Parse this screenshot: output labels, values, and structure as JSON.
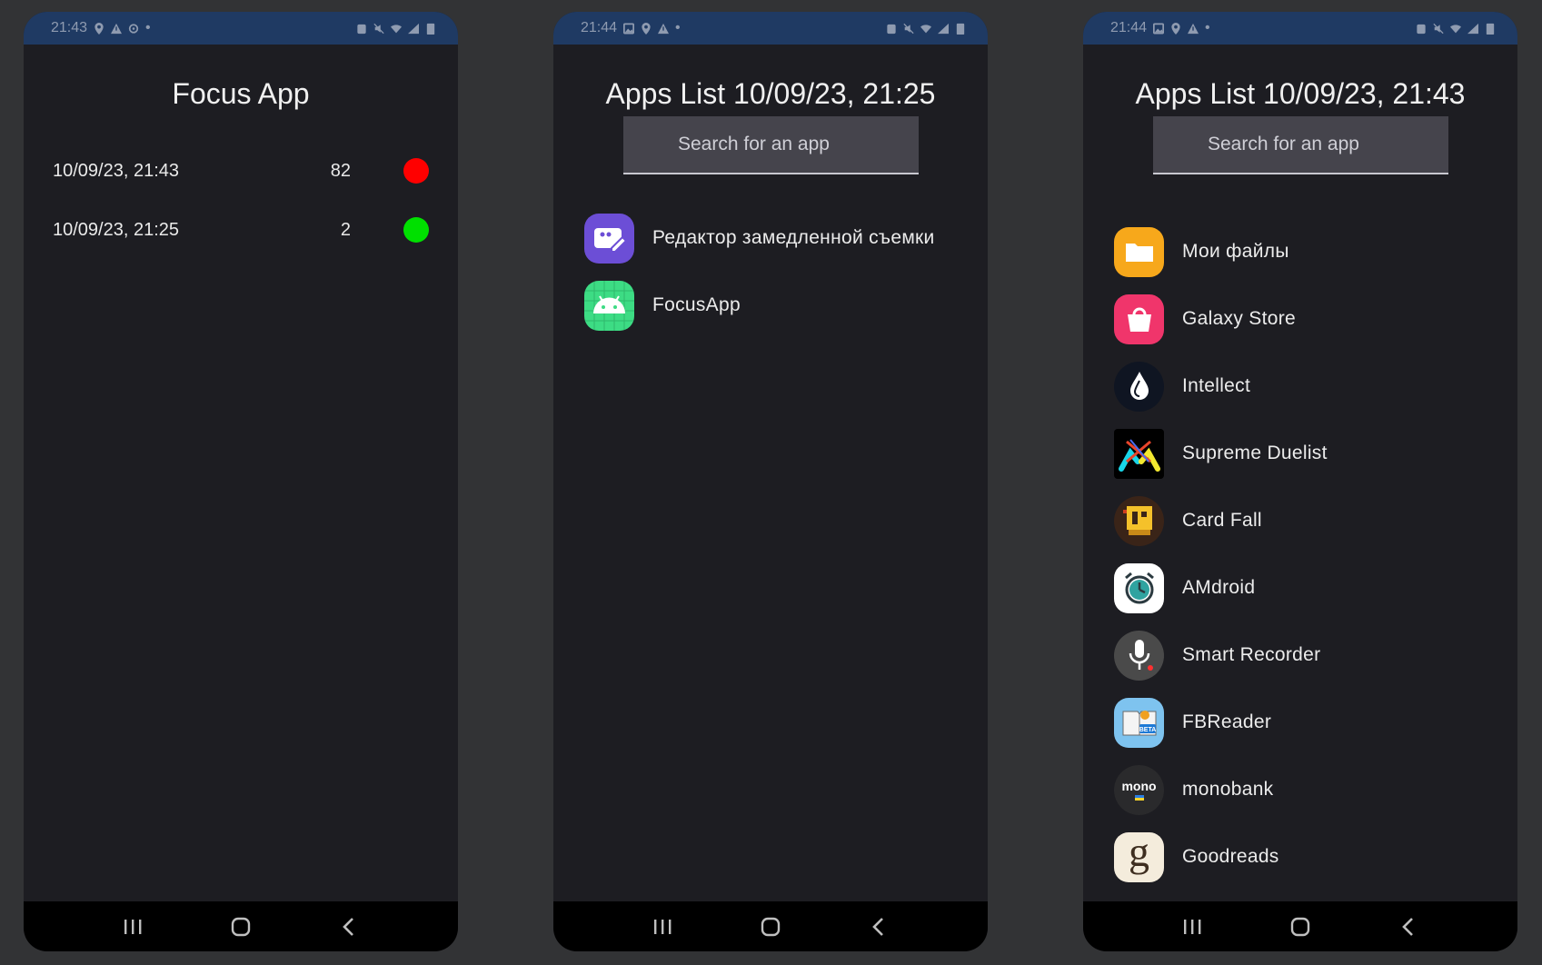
{
  "phones": [
    {
      "status_time": "21:43",
      "title": "Focus App",
      "sessions": [
        {
          "date": "10/09/23, 21:43",
          "count": "82",
          "status": "red"
        },
        {
          "date": "10/09/23, 21:25",
          "count": "2",
          "status": "green"
        }
      ]
    },
    {
      "status_time": "21:44",
      "title": "Apps List 10/09/23, 21:25",
      "search_placeholder": "Search for an app",
      "apps": [
        {
          "label": "Редактор замедленной съемки",
          "icon": "slow-motion-editor-icon"
        },
        {
          "label": "FocusApp",
          "icon": "android-icon"
        }
      ]
    },
    {
      "status_time": "21:44",
      "title": "Apps List 10/09/23, 21:43",
      "search_placeholder": "Search for an app",
      "apps": [
        {
          "label": "Мои файлы",
          "icon": "folder-icon"
        },
        {
          "label": "Galaxy Store",
          "icon": "shopping-bag-icon"
        },
        {
          "label": "Intellect",
          "icon": "drop-icon"
        },
        {
          "label": "Supreme Duelist",
          "icon": "duelist-icon"
        },
        {
          "label": "Card Fall",
          "icon": "card-fall-icon"
        },
        {
          "label": "AMdroid",
          "icon": "alarm-clock-icon"
        },
        {
          "label": "Smart Recorder",
          "icon": "microphone-icon"
        },
        {
          "label": "FBReader",
          "icon": "book-icon"
        },
        {
          "label": "monobank",
          "icon": "mono-icon"
        },
        {
          "label": "Goodreads",
          "icon": "goodreads-icon"
        }
      ]
    }
  ],
  "icon_text": {
    "mono": "mono",
    "beta": "BETA",
    "goodreads": "g"
  },
  "colors": {
    "status_bar": "#1f3a63",
    "screen_bg": "#1d1d22",
    "dot_red": "#ff0000",
    "dot_green": "#00e000"
  }
}
